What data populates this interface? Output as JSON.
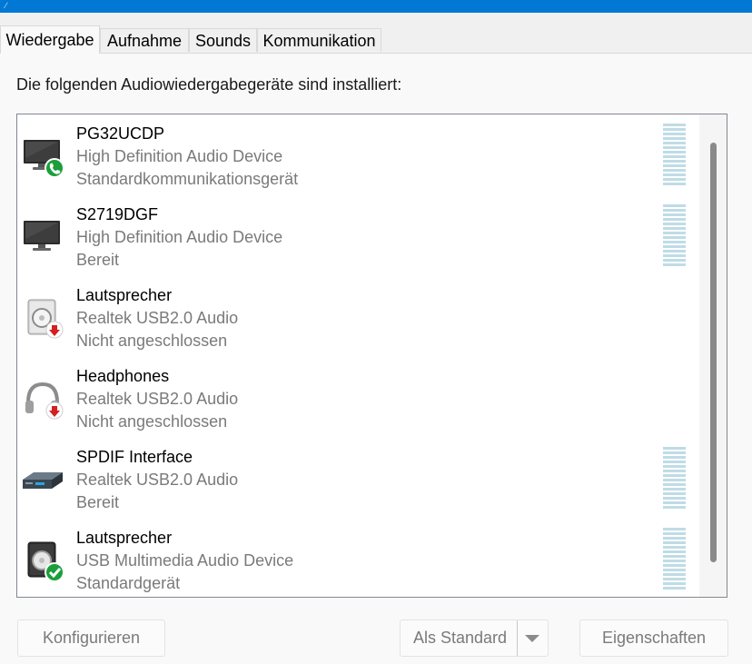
{
  "tabs": [
    "Wiedergabe",
    "Aufnahme",
    "Sounds",
    "Kommunikation"
  ],
  "intro": "Die folgenden Audiowiedergabegeräte sind installiert:",
  "devices": [
    {
      "name": "PG32UCDP",
      "driver": "High Definition Audio Device",
      "status": "Standardkommunikationsgerät",
      "icon": "monitor-icon",
      "badge": "phone-badge-icon",
      "meter": true
    },
    {
      "name": "S2719DGF",
      "driver": "High Definition Audio Device",
      "status": "Bereit",
      "icon": "monitor-icon",
      "badge": "",
      "meter": true
    },
    {
      "name": "Lautsprecher",
      "driver": "Realtek USB2.0 Audio",
      "status": "Nicht angeschlossen",
      "icon": "speaker-icon",
      "badge": "disconnected-badge-icon",
      "meter": false
    },
    {
      "name": "Headphones",
      "driver": "Realtek USB2.0 Audio",
      "status": "Nicht angeschlossen",
      "icon": "headphones-icon",
      "badge": "disconnected-badge-icon",
      "meter": false
    },
    {
      "name": "SPDIF Interface",
      "driver": "Realtek USB2.0 Audio",
      "status": "Bereit",
      "icon": "spdif-device-icon",
      "badge": "",
      "meter": true
    },
    {
      "name": "Lautsprecher",
      "driver": "USB Multimedia Audio Device",
      "status": "Standardgerät",
      "icon": "speaker-icon",
      "badge": "default-check-badge-icon",
      "meter": true
    }
  ],
  "buttons": {
    "configure": "Konfigurieren",
    "set_default": "Als Standard",
    "properties": "Eigenschaften"
  },
  "colors": {
    "accent": "#0078d4",
    "default_badge": "#1a9f3a",
    "disconnected_badge": "#d32020",
    "meter": "#bfdce6"
  }
}
